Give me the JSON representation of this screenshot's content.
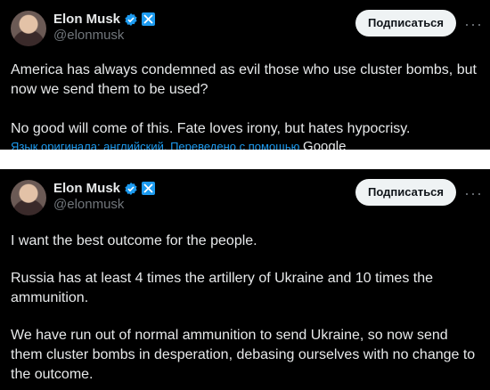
{
  "tweets": [
    {
      "author": {
        "name": "Elon Musk",
        "handle": "@elonmusk"
      },
      "subscribe_label": "Подписаться",
      "more_label": "···",
      "paragraphs": [
        "America has always condemned as evil those who use cluster bombs, but now we send them to be used?",
        "No good will come of this. Fate loves irony, but hates hypocrisy."
      ],
      "translation_note": "Язык оригинала: английский. Переведено с помощью",
      "translation_service": "Google"
    },
    {
      "author": {
        "name": "Elon Musk",
        "handle": "@elonmusk"
      },
      "subscribe_label": "Подписаться",
      "more_label": "···",
      "paragraphs": [
        "I want the best outcome for the people.",
        "Russia has at least 4 times the artillery of Ukraine and 10 times the ammunition.",
        "We have run out of normal ammunition to send Ukraine, so now send them cluster bombs in desperation, debasing ourselves with no change to the outcome."
      ]
    }
  ],
  "colors": {
    "background": "#000000",
    "text": "#e7e9ea",
    "secondary_text": "#71767b",
    "accent": "#1d9bf0",
    "button_bg": "#eff3f4"
  },
  "icons": {
    "verified": "verified-badge-icon",
    "affiliation": "x-affiliation-icon",
    "more": "more-options-icon"
  }
}
